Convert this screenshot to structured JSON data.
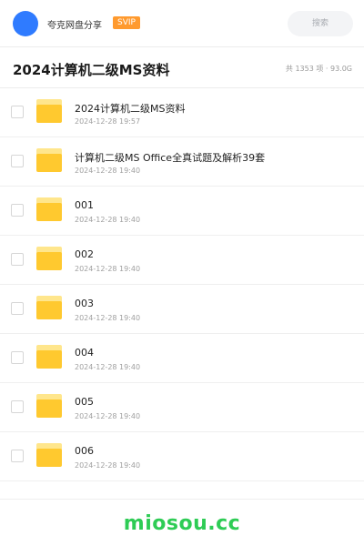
{
  "header": {
    "owner_name": "夸克网盘分享",
    "badge": "SVIP",
    "search_placeholder": "搜索"
  },
  "folder": {
    "title": "2024计算机二级MS资料",
    "meta": "共 1353 项 · 93.0G"
  },
  "files": [
    {
      "name": "2024计算机二级MS资料",
      "date": "2024-12-28 19:57"
    },
    {
      "name": "计算机二级MS Office全真试题及解析39套",
      "date": "2024-12-28 19:40"
    },
    {
      "name": "001",
      "date": "2024-12-28 19:40"
    },
    {
      "name": "002",
      "date": "2024-12-28 19:40"
    },
    {
      "name": "003",
      "date": "2024-12-28 19:40"
    },
    {
      "name": "004",
      "date": "2024-12-28 19:40"
    },
    {
      "name": "005",
      "date": "2024-12-28 19:40"
    },
    {
      "name": "006",
      "date": "2024-12-28 19:40"
    }
  ],
  "footer": {
    "brand": "miosou.cc"
  },
  "colors": {
    "accent_blue": "#2f7bff",
    "svip_orange": "#ff9a2e",
    "folder_yellow": "#ffc92f",
    "brand_green": "#2ecc55"
  }
}
